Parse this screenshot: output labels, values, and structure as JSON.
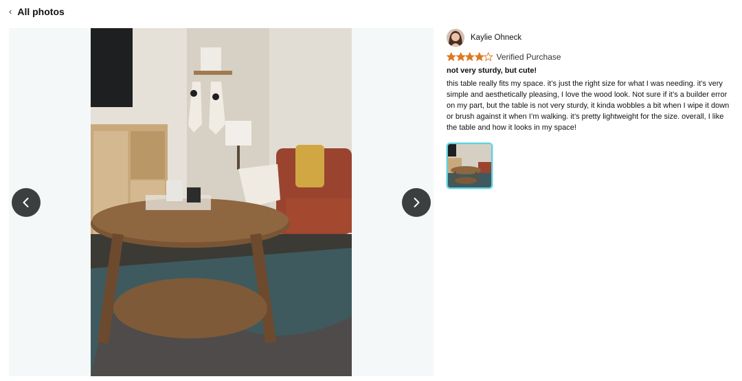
{
  "header": {
    "back_label": "All photos"
  },
  "viewer": {
    "prev_icon": "chevron-left-icon",
    "next_icon": "chevron-right-icon"
  },
  "review": {
    "reviewer_name": "Kaylie Ohneck",
    "rating": 4,
    "rating_max": 5,
    "star_color": "#de7921",
    "verified_label": "Verified Purchase",
    "title": "not very sturdy, but cute!",
    "body": "this table really fits my space. it’s just the right size for what I was needing. it’s very simple and aesthetically pleasing, I love the wood look. Not sure if it’s a builder error on my part, but the table is not very sturdy, it kinda wobbles a bit when I wipe it down or brush against it when I’m walking. it’s pretty lightweight for the size. overall, I like the table and how it looks in my space!"
  },
  "colors": {
    "thumb_border": "#5fd0e0",
    "nav_button": "#3b3f3f"
  }
}
